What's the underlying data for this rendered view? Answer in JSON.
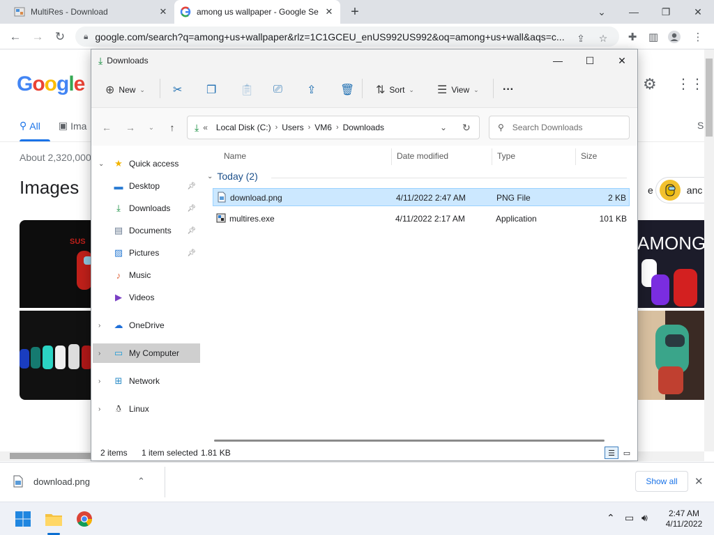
{
  "browser": {
    "tabs": [
      {
        "title": "MultiRes - Download",
        "active": false
      },
      {
        "title": "among us wallpaper - Google Se",
        "active": true
      }
    ],
    "url": "google.com/search?q=among+us+wallpaper&rlz=1C1GCEU_enUS992US992&oq=among+us+wall&aqs=c...",
    "accent": "#1a73e8"
  },
  "google": {
    "logo": "Google",
    "tabs": [
      "All",
      "Ima"
    ],
    "right_letter": "S",
    "results_count": "About 2,320,000",
    "images_heading": "Images",
    "chip_fragment_left": "e",
    "chip_fragment_right": "anc"
  },
  "explorer": {
    "title": "Downloads",
    "commands": {
      "new": "New",
      "sort": "Sort",
      "view": "View",
      "more": "···"
    },
    "breadcrumb": {
      "prefix": "«",
      "parts": [
        "Local Disk (C:)",
        "Users",
        "VM6",
        "Downloads"
      ]
    },
    "search_placeholder": "Search Downloads",
    "nav": [
      {
        "label": "Quick access",
        "icon": "star-icon"
      },
      {
        "label": "Desktop",
        "icon": "desktop-icon"
      },
      {
        "label": "Downloads",
        "icon": "download-icon"
      },
      {
        "label": "Documents",
        "icon": "documents-icon"
      },
      {
        "label": "Pictures",
        "icon": "pictures-icon"
      },
      {
        "label": "Music",
        "icon": "music-icon"
      },
      {
        "label": "Videos",
        "icon": "videos-icon"
      },
      {
        "label": "OneDrive",
        "icon": "cloud-icon"
      },
      {
        "label": "My Computer",
        "icon": "computer-icon"
      },
      {
        "label": "Network",
        "icon": "network-icon"
      },
      {
        "label": "Linux",
        "icon": "linux-icon"
      }
    ],
    "columns": [
      "Name",
      "Date modified",
      "Type",
      "Size"
    ],
    "group": "Today (2)",
    "files": [
      {
        "name": "download.png",
        "date": "4/11/2022 2:47 AM",
        "type": "PNG File",
        "size": "2 KB",
        "selected": true
      },
      {
        "name": "multires.exe",
        "date": "4/11/2022 2:17 AM",
        "type": "Application",
        "size": "101 KB",
        "selected": false
      }
    ],
    "status": {
      "items": "2 items",
      "selected": "1 item selected",
      "size": "1.81 KB"
    }
  },
  "shelf": {
    "file": "download.png",
    "show_all": "Show all"
  },
  "taskbar": {
    "time": "2:47 AM",
    "date": "4/11/2022"
  }
}
